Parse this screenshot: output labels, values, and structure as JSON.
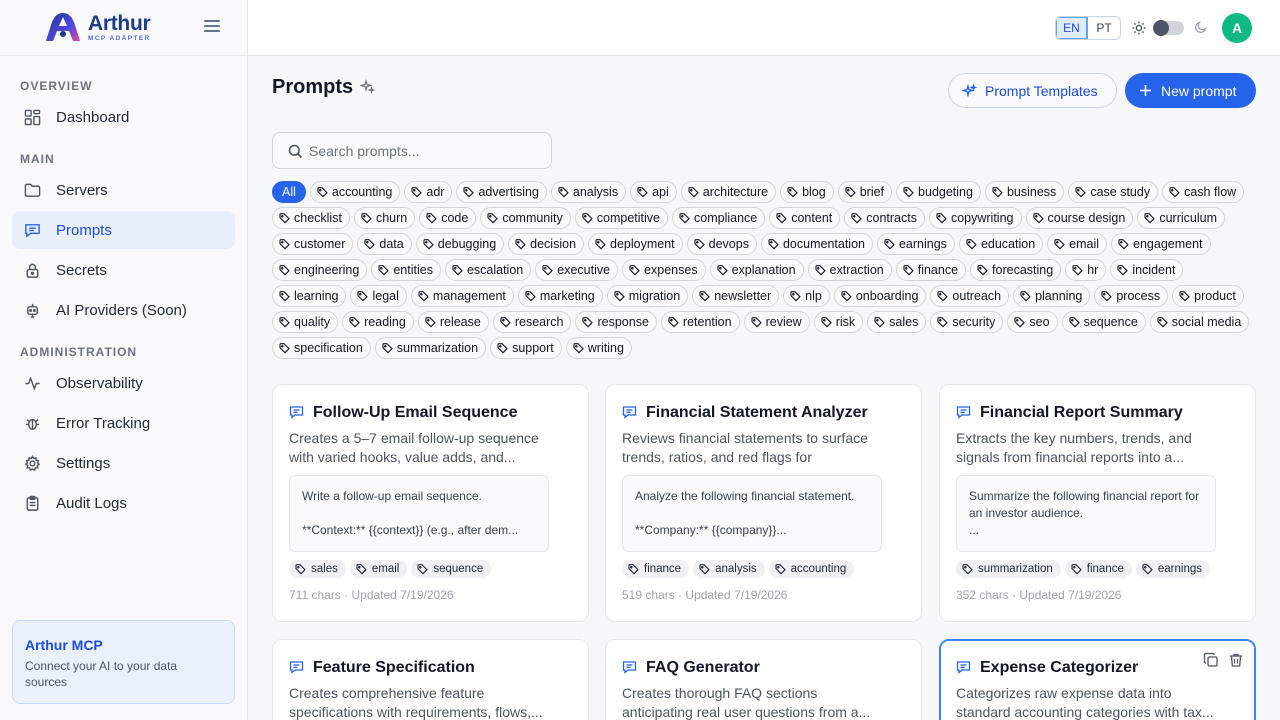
{
  "brand": {
    "name": "Arthur",
    "subtitle": "MCP ADAPTER"
  },
  "sidebar": {
    "sections": {
      "overview": "OVERVIEW",
      "main": "MAIN",
      "administration": "ADMINISTRATION"
    },
    "items": [
      {
        "label": "Dashboard",
        "icon": "dashboard-icon"
      },
      {
        "label": "Servers",
        "icon": "folder-icon"
      },
      {
        "label": "Prompts",
        "icon": "chat-icon",
        "active": true
      },
      {
        "label": "Secrets",
        "icon": "lock-icon"
      },
      {
        "label": "AI Providers (Soon)",
        "icon": "bot-icon"
      },
      {
        "label": "Observability",
        "icon": "activity-icon"
      },
      {
        "label": "Error Tracking",
        "icon": "bug-icon"
      },
      {
        "label": "Settings",
        "icon": "gear-icon"
      },
      {
        "label": "Audit Logs",
        "icon": "clipboard-icon"
      }
    ],
    "promo": {
      "title": "Arthur MCP",
      "text": "Connect your AI to your data sources"
    }
  },
  "header": {
    "lang_en": "EN",
    "lang_pt": "PT",
    "avatar": "A"
  },
  "main": {
    "title": "Prompts",
    "templates_button": "Prompt Templates",
    "new_button": "New prompt",
    "search_placeholder": "Search prompts...",
    "filter_all": "All",
    "filter_tags": [
      "accounting",
      "adr",
      "advertising",
      "analysis",
      "api",
      "architecture",
      "blog",
      "brief",
      "budgeting",
      "business",
      "case study",
      "cash flow",
      "checklist",
      "churn",
      "code",
      "community",
      "competitive",
      "compliance",
      "content",
      "contracts",
      "copywriting",
      "course design",
      "curriculum",
      "customer",
      "data",
      "debugging",
      "decision",
      "deployment",
      "devops",
      "documentation",
      "earnings",
      "education",
      "email",
      "engagement",
      "engineering",
      "entities",
      "escalation",
      "executive",
      "expenses",
      "explanation",
      "extraction",
      "finance",
      "forecasting",
      "hr",
      "incident",
      "learning",
      "legal",
      "management",
      "marketing",
      "migration",
      "newsletter",
      "nlp",
      "onboarding",
      "outreach",
      "planning",
      "process",
      "product",
      "quality",
      "reading",
      "release",
      "research",
      "response",
      "retention",
      "review",
      "risk",
      "sales",
      "security",
      "seo",
      "sequence",
      "social media",
      "specification",
      "summarization",
      "support",
      "writing"
    ],
    "cards": [
      {
        "title": "Follow-Up Email Sequence",
        "desc": "Creates a 5–7 email follow-up sequence with varied hooks, value adds, and...",
        "preview": "Write a follow-up email sequence.\n\n**Context:** {{context}} (e.g., after dem...",
        "tags": [
          "sales",
          "email",
          "sequence"
        ],
        "meta": "711 chars · Updated 7/19/2026"
      },
      {
        "title": "Financial Statement Analyzer",
        "desc": "Reviews financial statements to surface trends, ratios, and red flags for business...",
        "preview": "Analyze the following financial statement.\n\n**Company:** {{company}}...",
        "tags": [
          "finance",
          "analysis",
          "accounting"
        ],
        "meta": "519 chars · Updated 7/19/2026"
      },
      {
        "title": "Financial Report Summary",
        "desc": "Extracts the key numbers, trends, and signals from financial reports into a...",
        "preview": "Summarize the following financial report for an investor audience.\n...",
        "tags": [
          "summarization",
          "finance",
          "earnings"
        ],
        "meta": "352 chars · Updated 7/19/2026"
      },
      {
        "title": "Feature Specification",
        "desc": "Creates comprehensive feature specifications with requirements, flows,...",
        "preview": "",
        "tags": [],
        "meta": ""
      },
      {
        "title": "FAQ Generator",
        "desc": "Creates thorough FAQ sections anticipating real user questions from a...",
        "preview": "",
        "tags": [],
        "meta": ""
      },
      {
        "title": "Expense Categorizer",
        "desc": "Categorizes raw expense data into standard accounting categories with tax...",
        "preview": "",
        "tags": [],
        "meta": ""
      }
    ]
  },
  "colors": {
    "primary": "#2563eb",
    "avatar": "#10b981"
  }
}
